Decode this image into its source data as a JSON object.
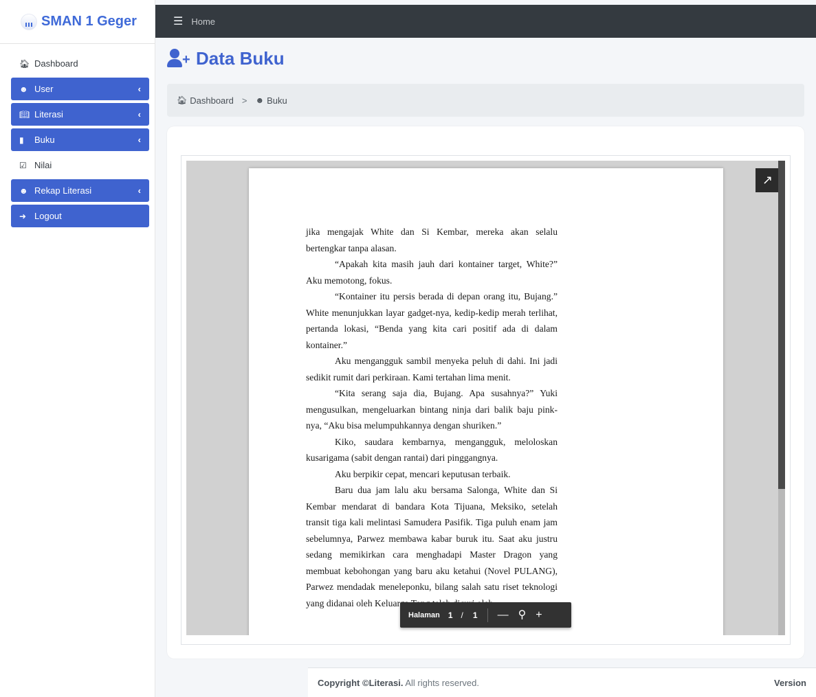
{
  "brand": {
    "name": "SMAN 1 Geger"
  },
  "sidebar": {
    "items": [
      {
        "label": "Dashboard",
        "icon": "home-icon",
        "active": false,
        "has_chevron": false
      },
      {
        "label": "User",
        "icon": "user-list-icon",
        "active": true,
        "has_chevron": true
      },
      {
        "label": "Literasi",
        "icon": "open-book-icon",
        "active": true,
        "has_chevron": true
      },
      {
        "label": "Buku",
        "icon": "book-icon",
        "active": true,
        "has_chevron": true
      },
      {
        "label": "Nilai",
        "icon": "checkbox-icon",
        "active": false,
        "has_chevron": false
      },
      {
        "label": "Rekap Literasi",
        "icon": "users-icon",
        "active": true,
        "has_chevron": true
      },
      {
        "label": "Logout",
        "icon": "sign-out-icon",
        "active": true,
        "has_chevron": false
      }
    ]
  },
  "topbar": {
    "home_label": "Home"
  },
  "page": {
    "title": "Data Buku"
  },
  "breadcrumb": {
    "home": "Dashboard",
    "separator": ">",
    "current": "Buku"
  },
  "pdf": {
    "paragraphs": [
      "jika mengajak White dan Si Kembar, mereka akan selalu bertengkar tanpa alasan.",
      "“Apakah kita masih jauh dari kontainer target, White?” Aku memotong, fokus.",
      "“Kontainer itu persis berada di depan orang itu, Bujang.” White menunjukkan layar gadget-nya, kedip-kedip merah terlihat, pertanda lokasi, “Benda yang kita cari positif ada di dalam kontainer.”",
      "Aku mengangguk sambil menyeka peluh di dahi. Ini jadi sedikit rumit dari perkiraan. Kami tertahan lima menit.",
      "“Kita serang saja dia, Bujang. Apa susahnya?” Yuki mengusulkan, mengeluarkan bintang ninja dari balik baju pink-nya, “Aku bisa melumpuhkannya dengan shuriken.”",
      "Kiko, saudara kembarnya, mengangguk, meloloskan kusarigama (sabit dengan rantai) dari pinggangnya.",
      "Aku berpikir cepat, mencari keputusan terbaik.",
      "Baru dua jam lalu aku bersama Salonga, White dan Si Kembar mendarat di bandara Kota Tijuana, Meksiko, setelah transit tiga kali melintasi Samudera Pasifik. Tiga puluh enam jam sebelumnya, Parwez membawa kabar buruk itu. Saat aku justru sedang memikirkan cara menghadapi Master Dragon yang membuat kebohongan yang baru aku ketahui (Novel PULANG), Parwez mendadak meneleponku, bilang salah satu riset teknologi yang didanai oleh Keluarga Tong telah dicuri oleh"
    ],
    "pager": {
      "label": "Halaman",
      "current": "1",
      "slash": "/",
      "total": "1",
      "zoom_out": "—",
      "zoom_fit": "⚲",
      "zoom_in": "+"
    },
    "popout_icon": "external-link-icon"
  },
  "footer": {
    "copyright_bold": "Copyright ©Literasi.",
    "copyright_rest": " All rights reserved.",
    "version_label": "Version"
  }
}
